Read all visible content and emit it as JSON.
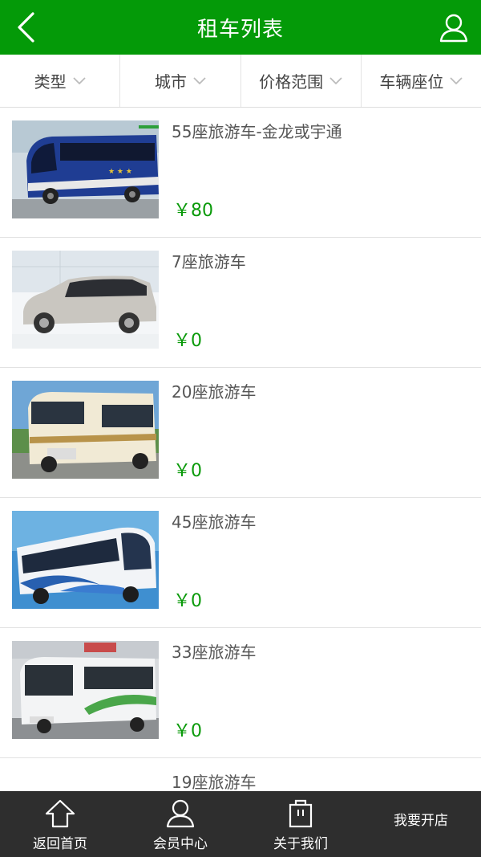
{
  "header": {
    "title": "租车列表"
  },
  "filters": [
    {
      "label": "类型"
    },
    {
      "label": "城市"
    },
    {
      "label": "价格范围"
    },
    {
      "label": "车辆座位"
    }
  ],
  "items": [
    {
      "name": "55座旅游车-金龙或宇通",
      "price": "￥80",
      "image": "blue-coach"
    },
    {
      "name": "7座旅游车",
      "price": "￥0",
      "image": "silver-mpv"
    },
    {
      "name": "20座旅游车",
      "price": "￥0",
      "image": "cream-minibus"
    },
    {
      "name": "45座旅游车",
      "price": "￥0",
      "image": "blue-white-coach"
    },
    {
      "name": "33座旅游车",
      "price": "￥0",
      "image": "white-green-bus"
    },
    {
      "name": "19座旅游车",
      "price": "",
      "image": ""
    }
  ],
  "bottom_nav": [
    {
      "label": "返回首页",
      "icon": "home-icon"
    },
    {
      "label": "会员中心",
      "icon": "user-icon"
    },
    {
      "label": "关于我们",
      "icon": "bag-icon"
    },
    {
      "label": "我要开店",
      "icon": ""
    }
  ],
  "colors": {
    "accent": "#049a08",
    "price": "#0a9a0a",
    "nav_bg": "#2e2e2e"
  }
}
